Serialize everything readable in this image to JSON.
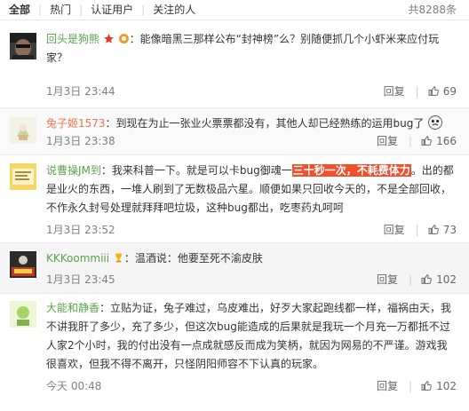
{
  "tabs": [
    {
      "label": "全部"
    },
    {
      "label": "热门"
    },
    {
      "label": "认证用户"
    },
    {
      "label": "关注的人"
    }
  ],
  "total_count": "共8288条",
  "colors": {
    "username": "#eb7350",
    "highlight": "#f24f2b",
    "meta": "#808080"
  },
  "comments": [
    {
      "username": "回头是狗熊",
      "badges": [
        "star-badge-icon",
        "shield-badge-icon"
      ],
      "text": "：能像暗黑三那样公布“封神榜”么？别随便抓几个小虾米来应付玩家？",
      "time": "1月3日 23:44",
      "reply_label": "回复",
      "likes": "69"
    },
    {
      "username": "兔子姬1573",
      "text": "：到现在为止一张业火票票都没有，其他人却已经熟练的运用bug了",
      "emoji": "face-emoji",
      "time": "1月3日 23:38",
      "reply_label": "回复",
      "likes": "166"
    },
    {
      "username": "说曹操JM到",
      "text_before": "：我来科普一下。就是可以卡bug御魂一",
      "highlight": "三十秒一次，不耗费体力",
      "text_after": "。出的都是业火的东西，一堆人刷到了无数极品六星。顺便如果只回收今天的，不是全部回收，不作永久封号处理就拜拜吧垃圾，这种bug都出，吃枣药丸呵呵",
      "time": "1月3日 23:52",
      "reply_label": "回复",
      "likes": "73"
    },
    {
      "username": "KKKoommiii",
      "badges": [
        "trophy-badge-icon"
      ],
      "text": "：温酒说：他要至死不渝皮肤",
      "time": "1月3日 23:45",
      "reply_label": "回复",
      "likes": "102"
    },
    {
      "username": "大能和静香",
      "text": "：立贴为证，兔子难过，乌皮难出，好歹大家起跑线都一样，福祸由天，我不讲我肝了多少，充了多少，但这次bug能造成的后果就是我玩一个月充一万都抵不过人家2个小时，我的付出没有一点成就感反而成为笑柄，就因为网易的不严谨。游戏我很喜欢，但我不得不离开，只怪阴阳师容不下认真的玩家。",
      "time": "今天 00:48",
      "reply_label": "回复",
      "likes": "102"
    }
  ]
}
